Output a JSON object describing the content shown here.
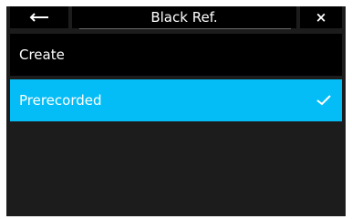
{
  "header": {
    "title": "Black Ref.",
    "back_icon": "arrow-left-icon",
    "close_symbol": "×"
  },
  "list": {
    "items": [
      {
        "label": "Create",
        "selected": false
      },
      {
        "label": "Prerecorded",
        "selected": true
      }
    ]
  },
  "colors": {
    "selected": "#05bdf6",
    "background": "#1c1c1c",
    "item": "#000000",
    "text": "#ffffff"
  }
}
